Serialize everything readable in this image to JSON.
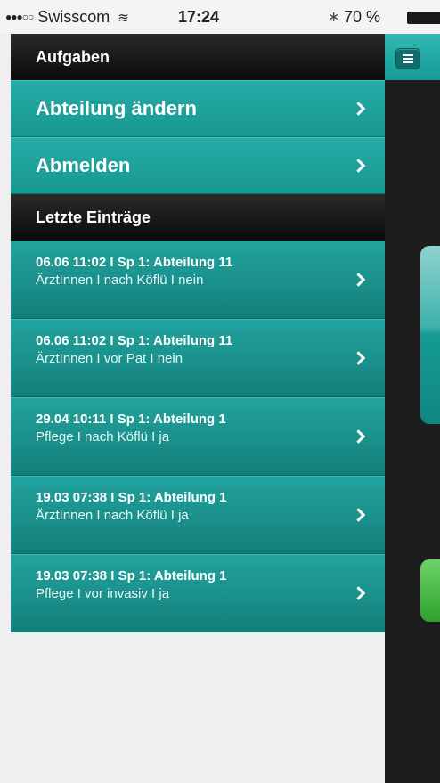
{
  "status_bar": {
    "signal": "●●●○○",
    "carrier": "Swisscom",
    "time": "17:24",
    "battery": "70 %"
  },
  "menu": {
    "tasks_header": "Aufgaben",
    "items": [
      {
        "label": "Abteilung ändern"
      },
      {
        "label": "Abmelden"
      }
    ],
    "recent_header": "Letzte Einträge",
    "entries": [
      {
        "title": "06.06 11:02 I Sp 1: Abteilung 11",
        "detail": "ÄrztInnen I nach Köflü I nein"
      },
      {
        "title": "06.06 11:02 I Sp 1: Abteilung 11",
        "detail": "ÄrztInnen I vor Pat I nein"
      },
      {
        "title": "29.04 10:11 I Sp 1: Abteilung 1",
        "detail": "Pflege I nach Köflü I ja"
      },
      {
        "title": "19.03 07:38 I Sp 1: Abteilung 1",
        "detail": "ÄrztInnen I nach Köflü I ja"
      },
      {
        "title": "19.03 07:38 I Sp 1: Abteilung 1",
        "detail": "Pflege I vor invasiv I ja"
      }
    ]
  },
  "colors": {
    "teal": "#1a9e99",
    "header_dark": "#111111",
    "green": "#3bb137"
  }
}
